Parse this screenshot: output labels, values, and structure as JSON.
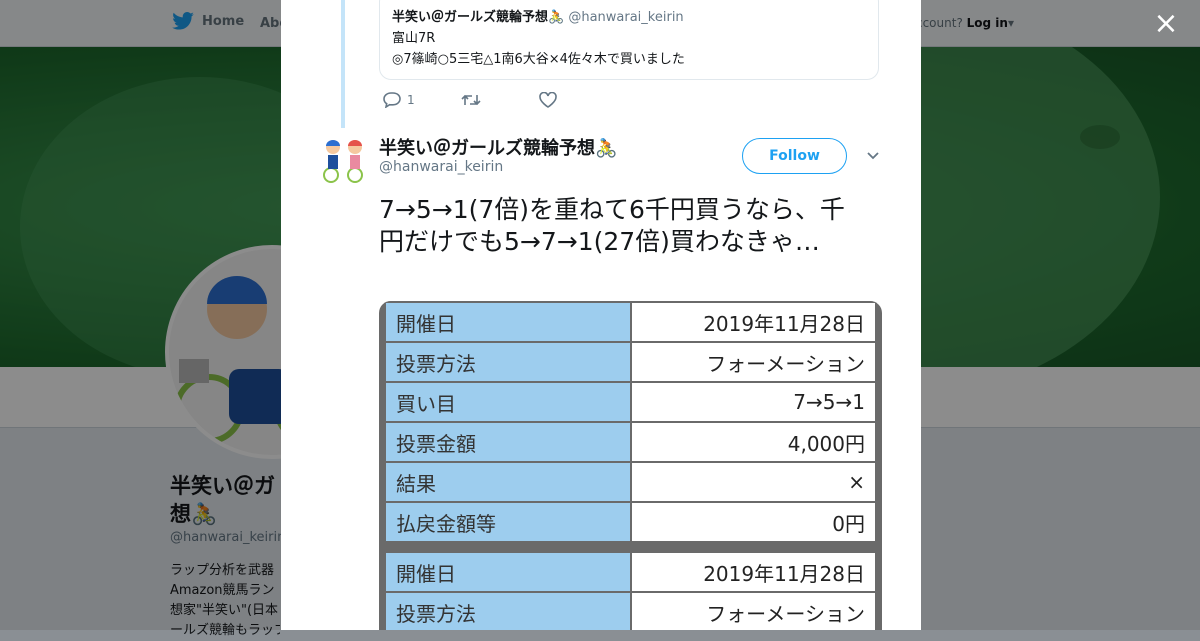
{
  "topbar": {
    "home_label": "Home",
    "about_label": "Abo",
    "account_prompt": "ccount?",
    "login_label": "Log in"
  },
  "profile": {
    "name": "半笑い＠ガールズ競輪予想🚴",
    "name_line1": "半笑い＠ガ",
    "name_line2": "想🚴",
    "handle": "@hanwarai_keirin",
    "handle_visible": "@hanwarai_keirin",
    "bio_lines": [
      "ラップ分析を武器",
      "Amazon競馬ラン",
      "想家\"半笑い\"(日本",
      "ールズ競輪もラップ"
    ]
  },
  "modal": {
    "close_icon": "×",
    "quoted": {
      "name": "半笑い＠ガールズ競輪予想🚴",
      "handle": "@hanwarai_keirin",
      "line1": "富山7R",
      "line2": "◎7篠崎○5三宅△1南6大谷×4佐々木で買いました"
    },
    "actions": {
      "reply_count": "1",
      "retweet_count": "",
      "like_count": ""
    },
    "tweet": {
      "author_name": "半笑い＠ガールズ競輪予想🚴",
      "author_handle": "@hanwarai_keirin",
      "follow_label": "Follow",
      "text": "7→5→1(7倍)を重ねて6千円買うなら、千円だけでも5→7→1(27倍)買わなきゃ…"
    },
    "table1": [
      {
        "k": "開催日",
        "v": "2019年11月28日"
      },
      {
        "k": "投票方法",
        "v": "フォーメーション"
      },
      {
        "k": "買い目",
        "v": "7→5→1"
      },
      {
        "k": "投票金額",
        "v": "4,000円"
      },
      {
        "k": "結果",
        "v": "×"
      },
      {
        "k": "払戻金額等",
        "v": "0円"
      }
    ],
    "table2": [
      {
        "k": "開催日",
        "v": "2019年11月28日"
      },
      {
        "k": "投票方法",
        "v": "フォーメーション"
      }
    ]
  },
  "colors": {
    "twitter_blue": "#1da1f2",
    "table_key_bg": "#9dcdee",
    "banner_green": "#2e8a44"
  }
}
